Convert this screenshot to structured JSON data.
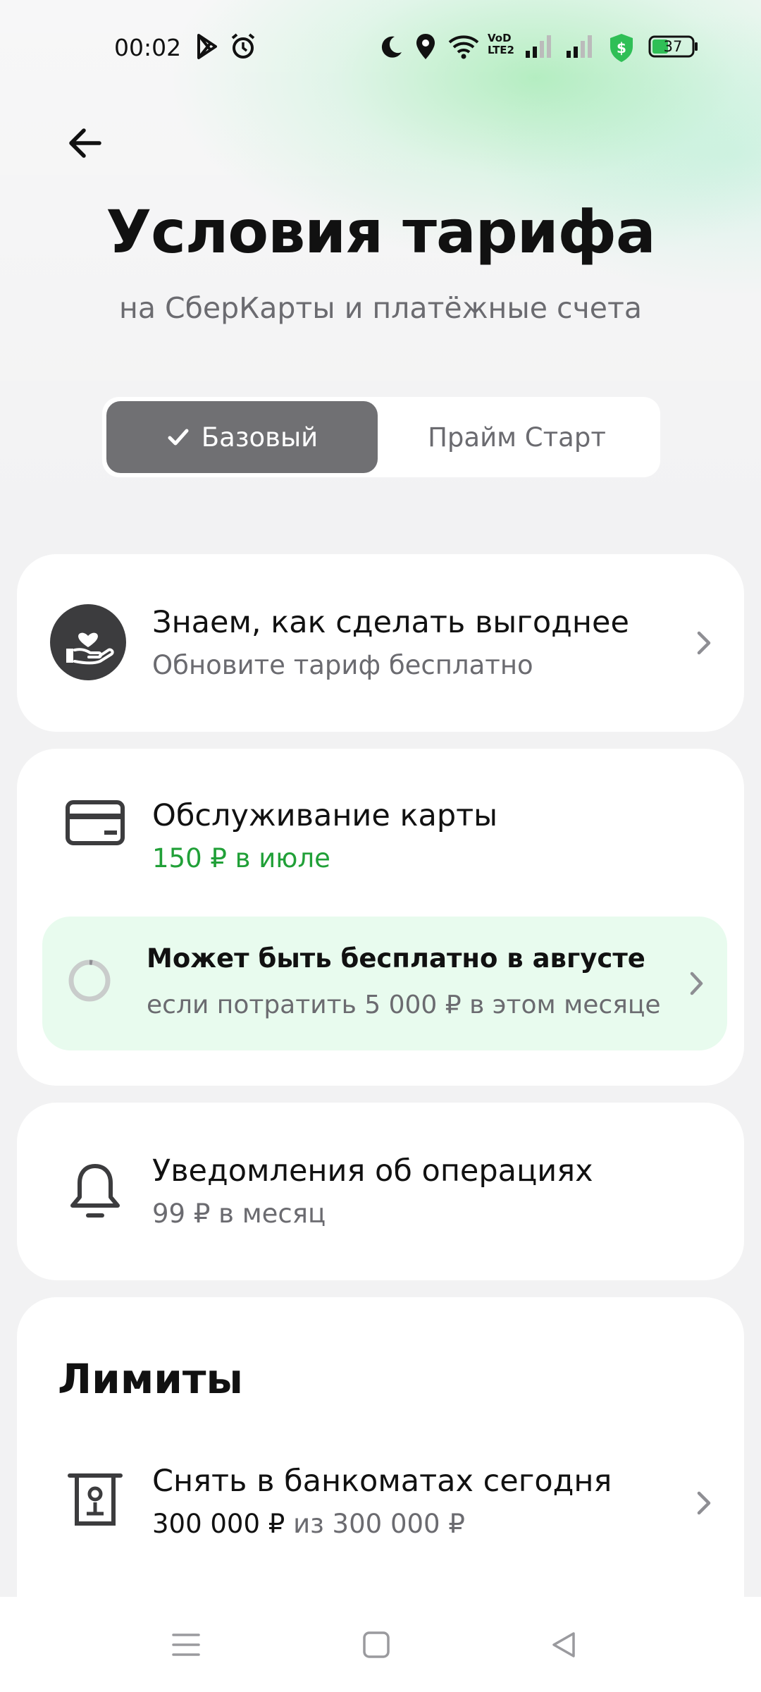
{
  "status_bar": {
    "time": "00:02",
    "battery": "37",
    "icons": [
      "play-store-icon",
      "alarm-icon",
      "moon-icon",
      "location-icon",
      "wifi-icon",
      "volte-icon",
      "signal-icon",
      "signal-icon",
      "shield-dollar-icon",
      "battery-icon"
    ]
  },
  "header": {
    "title": "Условия тарифа",
    "subtitle": "на СберКарты и платёжные счета"
  },
  "tabs": [
    {
      "label": "Базовый",
      "selected": true
    },
    {
      "label": "Прайм Старт",
      "selected": false
    }
  ],
  "upgrade": {
    "title": "Знаем, как сделать выгоднее",
    "subtitle": "Обновите тариф бесплатно"
  },
  "card_service": {
    "title": "Обслуживание карты",
    "price": "150 ₽ в июле",
    "promo_title": "Может быть бесплатно в августе",
    "promo_subtitle": "если потратить 5 000 ₽ в этом месяце"
  },
  "notifications": {
    "title": "Уведомления об операциях",
    "price": "99 ₽ в месяц"
  },
  "limits": {
    "section_title": "Лимиты",
    "atm_title": "Снять в банкоматах сегодня",
    "atm_available": "300 000 ₽",
    "atm_total": "из 300 000 ₽"
  },
  "colors": {
    "accent_green": "#21a038",
    "promo_bg": "#e8fbee",
    "segment_active": "#707073"
  }
}
